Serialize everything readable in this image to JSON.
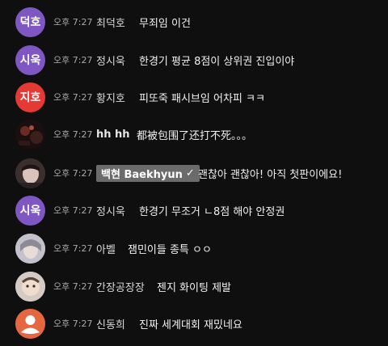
{
  "messages": [
    {
      "initials": "덕호",
      "avatar_color": "#7e57c2",
      "time": "오후 7:27",
      "author": "최덕호",
      "text": "무죄임 이건"
    },
    {
      "initials": "시욱",
      "avatar_color": "#7e57c2",
      "time": "오후 7:27",
      "author": "정시욱",
      "text": "한경기 평균 8점이 상위권 진입이야"
    },
    {
      "initials": "지호",
      "avatar_color": "#e53935",
      "time": "오후 7:27",
      "author": "황지호",
      "text": "피또죽 패시브임 어차피 ㅋㅋ"
    },
    {
      "avatar_color": "#2a1a1a",
      "time": "오후 7:27",
      "author": "hh hh",
      "text": "都被包围了还打不死。。。"
    },
    {
      "avatar_color": "#5a4a48",
      "time": "오후 7:27",
      "author": "백현 Baekhyun",
      "verified": "✓",
      "text": "괜찮아 괜찮아! 아직 첫판이에요!"
    },
    {
      "initials": "시욱",
      "avatar_color": "#7e57c2",
      "time": "오후 7:27",
      "author": "정시욱",
      "text": "한경기 무조거 ㄴ8점 해야 안정권"
    },
    {
      "avatar_color": "#b9b7c2",
      "time": "오후 7:27",
      "author": "아벨",
      "text": "잼민이들 종특 ㅇㅇ"
    },
    {
      "avatar_color": "#c9c2bb",
      "time": "오후 7:27",
      "author": "간장공장장",
      "text": "젠지 화이팅 제발"
    },
    {
      "avatar_color": "#e5673f",
      "time": "오후 7:27",
      "author": "신동희",
      "text": "진짜 세계대회 재밌네요"
    }
  ]
}
